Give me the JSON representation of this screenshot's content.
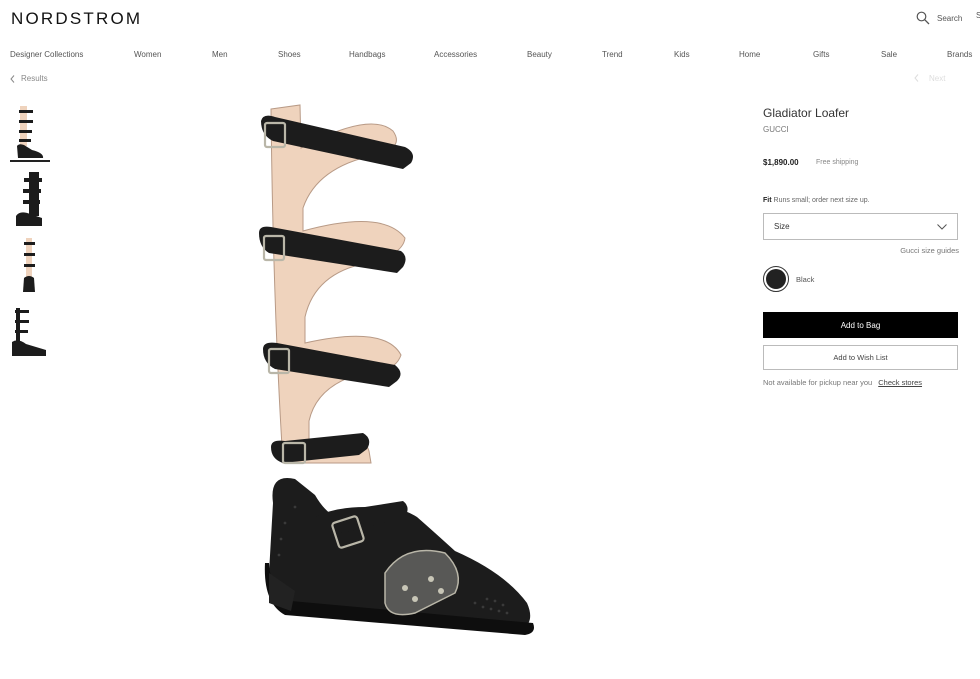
{
  "header": {
    "logo": "NORDSTROM",
    "search_label": "Search",
    "search_icon": "search-icon",
    "cart_edge": "S"
  },
  "nav": {
    "items": [
      "Designer Collections",
      "Women",
      "Men",
      "Shoes",
      "Handbags",
      "Accessories",
      "Beauty",
      "Trend",
      "Kids",
      "Home",
      "Gifts",
      "Sale",
      "Brands"
    ]
  },
  "breadcrumb": {
    "back_label": "Results",
    "next_label": "Next"
  },
  "gallery": {
    "thumbnail_count": 4,
    "active_index": 0
  },
  "product": {
    "title": "Gladiator Loafer",
    "brand": "GUCCI",
    "price": "$1,890.00",
    "shipping": "Free shipping",
    "fit_label": "Fit",
    "fit_text": "Runs small; order next size up.",
    "size_placeholder": "Size",
    "size_guide": "Gucci size guides",
    "color_name": "Black",
    "add_to_bag": "Add to Bag",
    "add_to_wishlist": "Add to Wish List",
    "pickup_text": "Not available for pickup near you",
    "check_stores": "Check stores"
  },
  "colors": {
    "primary_button": "#000000",
    "text": "#393939",
    "border": "#bbbbbb",
    "leather": "#1c1c1c",
    "lining": "#efd3bd"
  }
}
